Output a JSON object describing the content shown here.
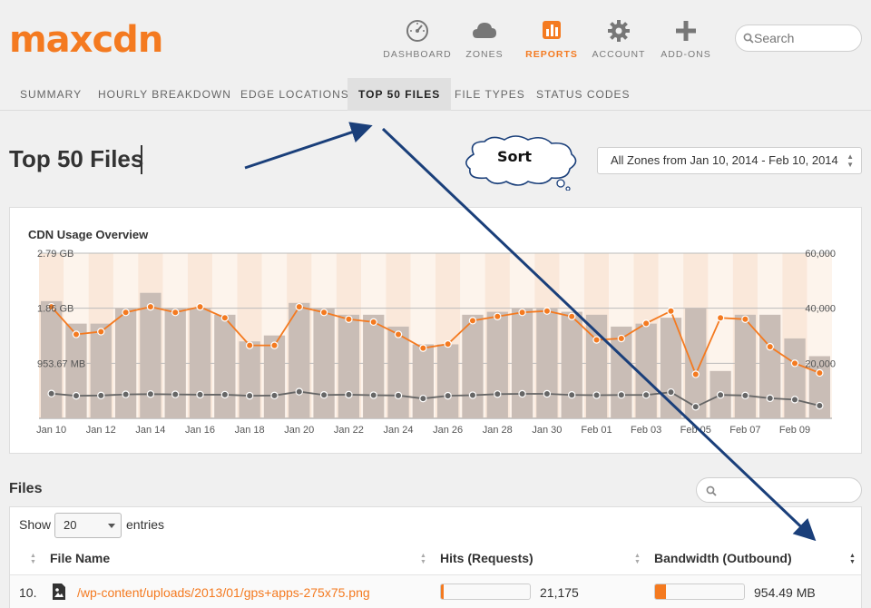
{
  "brand": {
    "logo_text": "maxcdn"
  },
  "nav": [
    {
      "label": "DASHBOARD",
      "icon": "gauge-icon",
      "active": false
    },
    {
      "label": "ZONES",
      "icon": "cloud-icon",
      "active": false
    },
    {
      "label": "REPORTS",
      "icon": "bar-chart-icon",
      "active": true
    },
    {
      "label": "ACCOUNT",
      "icon": "gear-icon",
      "active": false
    },
    {
      "label": "ADD-ONS",
      "icon": "plus-icon",
      "active": false
    }
  ],
  "search": {
    "placeholder": "Search"
  },
  "subnav": [
    {
      "label": "SUMMARY"
    },
    {
      "label": "HOURLY BREAKDOWN"
    },
    {
      "label": "EDGE LOCATIONS"
    },
    {
      "label": "TOP 50 FILES",
      "active": true
    },
    {
      "label": "FILE TYPES"
    },
    {
      "label": "STATUS CODES"
    }
  ],
  "page_title": "Top 50 Files",
  "zone_filter": {
    "value": "All Zones from Jan 10, 2014 - Feb 10, 2014"
  },
  "annotation": {
    "callout_text": "Sort"
  },
  "chart": {
    "title": "CDN Usage Overview"
  },
  "chart_data": {
    "type": "bar",
    "title": "CDN Usage Overview",
    "left_axis_ticks": [
      "2.79 GB",
      "1.86 GB",
      "953.67 MB"
    ],
    "right_axis_ticks": [
      "60,000",
      "40,000",
      "20,000"
    ],
    "right_axis_range": [
      0,
      60000
    ],
    "x_tick_labels": [
      "Jan 10",
      "Jan 12",
      "Jan 14",
      "Jan 16",
      "Jan 18",
      "Jan 20",
      "Jan 22",
      "Jan 24",
      "Jan 26",
      "Jan 28",
      "Jan 30",
      "Feb 01",
      "Feb 03",
      "Feb 05",
      "Feb 07",
      "Feb 09"
    ],
    "days": 32,
    "grid": true,
    "series": [
      {
        "type": "bar",
        "color": "#c9bdb6",
        "values": [
          1.98,
          1.6,
          1.6,
          1.86,
          2.12,
          1.86,
          1.86,
          1.75,
          1.3,
          1.4,
          1.95,
          1.86,
          1.75,
          1.75,
          1.55,
          1.25,
          1.25,
          1.75,
          1.8,
          1.86,
          1.86,
          1.8,
          1.75,
          1.55,
          1.6,
          1.7,
          1.86,
          0.8,
          1.75,
          1.75,
          1.35,
          1.05
        ]
      },
      {
        "type": "line",
        "color": "#f47a20",
        "values": [
          40500,
          30500,
          31500,
          38500,
          40500,
          38500,
          40500,
          36500,
          26500,
          26500,
          40500,
          38500,
          36000,
          35000,
          30500,
          25500,
          27000,
          35500,
          37000,
          38500,
          39000,
          37000,
          28500,
          29000,
          34500,
          39000,
          16000,
          36500,
          36000,
          26000,
          20000,
          16500
        ]
      },
      {
        "type": "line",
        "color": "#666666",
        "values": [
          9000,
          8200,
          8300,
          8700,
          8800,
          8700,
          8600,
          8600,
          8200,
          8300,
          9700,
          8500,
          8600,
          8400,
          8300,
          7200,
          8200,
          8400,
          8800,
          8900,
          8900,
          8500,
          8400,
          8500,
          8500,
          9500,
          4200,
          8500,
          8300,
          7300,
          6800,
          4600
        ]
      }
    ]
  },
  "files": {
    "title": "Files",
    "show_label": "Show",
    "entries_label": "entries",
    "page_size": "20",
    "columns": [
      "File Name",
      "Hits (Requests)",
      "Bandwidth (Outbound)"
    ],
    "rows": [
      {
        "rank": "10.",
        "file": "/wp-content/uploads/2013/01/gps+apps-275x75.png",
        "hits": "21,175",
        "hits_fraction": 0.03,
        "bandwidth": "954.49 MB",
        "bandwidth_fraction": 0.12
      }
    ]
  }
}
